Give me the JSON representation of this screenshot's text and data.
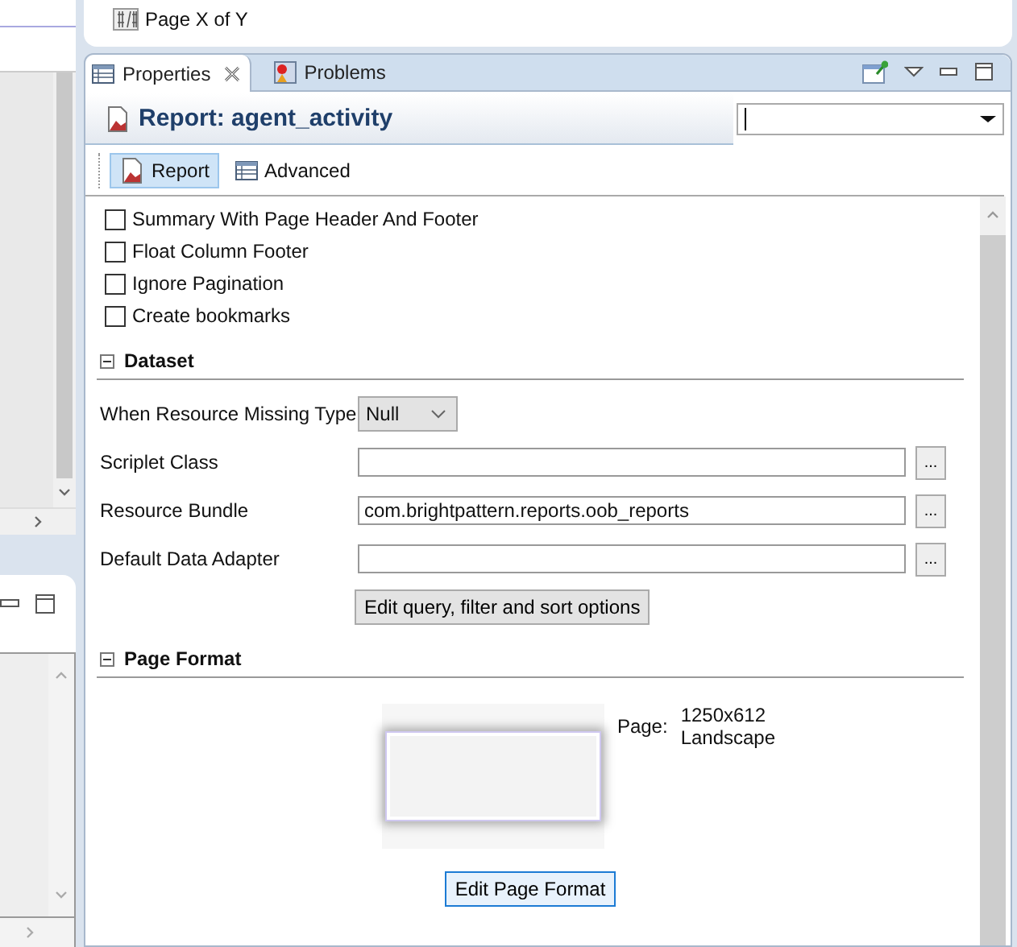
{
  "top_panel": {
    "item": "Page X of Y"
  },
  "tabs": [
    {
      "label": "Properties",
      "selected": true,
      "closable": true
    },
    {
      "label": "Problems",
      "selected": false,
      "closable": false
    }
  ],
  "header": {
    "title": "Report: agent_activity"
  },
  "subtabs": [
    {
      "label": "Report",
      "selected": true
    },
    {
      "label": "Advanced",
      "selected": false
    }
  ],
  "options": [
    {
      "label": "Summary With Page Header And Footer",
      "checked": false
    },
    {
      "label": "Float Column Footer",
      "checked": false
    },
    {
      "label": "Ignore Pagination",
      "checked": false
    },
    {
      "label": "Create bookmarks",
      "checked": false
    }
  ],
  "dataset": {
    "title": "Dataset",
    "expanded": true,
    "missing_type": {
      "label": "When Resource Missing Type",
      "value": "Null"
    },
    "fields": [
      {
        "label": "Scriplet Class",
        "browse": "..."
      },
      {
        "label": "Resource Bundle",
        "value": "com.brightpattern.reports.oob_reports",
        "browse": "..."
      },
      {
        "label": "Default Data Adapter",
        "browse": "..."
      }
    ],
    "button": "Edit query, filter and sort options"
  },
  "page_format": {
    "title": "Page Format",
    "expanded": true,
    "page_label": "Page:",
    "size": "1250x612",
    "orientation": "Landscape",
    "button": "Edit Page Format"
  }
}
